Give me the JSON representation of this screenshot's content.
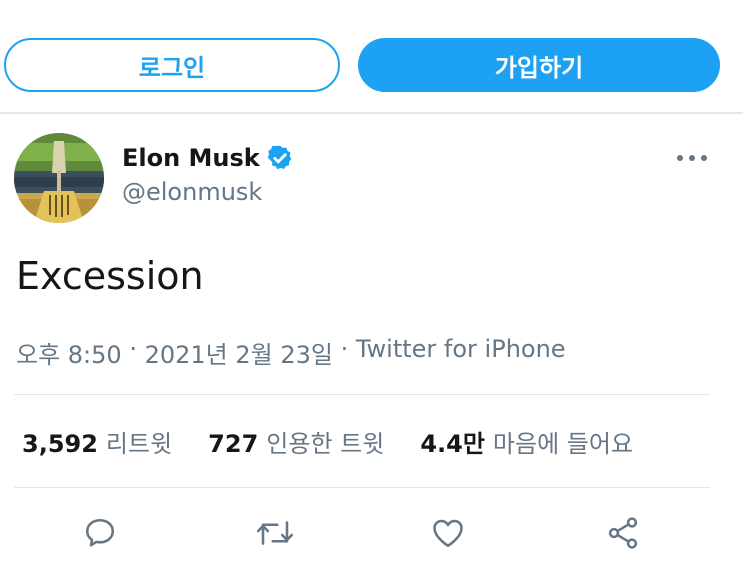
{
  "auth": {
    "login_label": "로그인",
    "signup_label": "가입하기"
  },
  "tweet": {
    "display_name": "Elon Musk",
    "handle": "@elonmusk",
    "verified": true,
    "text": "Excession",
    "time": "오후 8:50",
    "separator_1": " · ",
    "date": "2021년 2월 23일",
    "separator_2": " · ",
    "source": "Twitter for iPhone"
  },
  "stats": {
    "retweets_count": "3,592",
    "retweets_label": "리트윗",
    "quotes_count": "727",
    "quotes_label": "인용한 트윗",
    "likes_count": "4.4만",
    "likes_label": "마음에 들어요"
  },
  "icons": {
    "more": "more-icon",
    "reply": "reply-icon",
    "retweet": "retweet-icon",
    "like": "like-icon",
    "share": "share-icon",
    "verified": "verified-badge-icon"
  },
  "colors": {
    "brand": "#1da1f2",
    "text_primary": "#14171a",
    "text_secondary": "#657786",
    "divider": "#e1e8ed"
  }
}
